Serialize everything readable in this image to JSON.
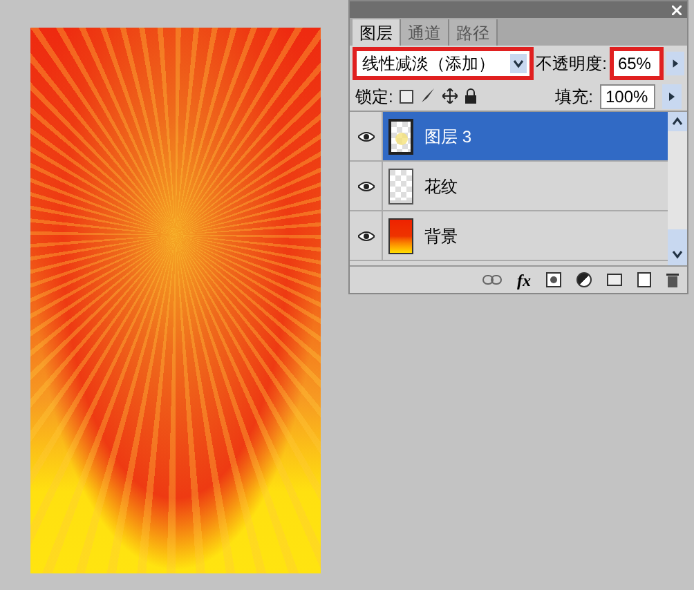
{
  "panel": {
    "tabs": [
      {
        "label": "图层",
        "selected": true
      },
      {
        "label": "通道",
        "selected": false
      },
      {
        "label": "路径",
        "selected": false
      }
    ],
    "blend_mode": {
      "value": "线性减淡（添加）",
      "highlighted": true
    },
    "opacity": {
      "label": "不透明度:",
      "value": "65%",
      "highlighted": true
    },
    "lock": {
      "label": "锁定:"
    },
    "fill": {
      "label": "填充:",
      "value": "100%"
    },
    "layers": [
      {
        "name": "图层 3",
        "selected": true,
        "visible": true,
        "kind": "glow"
      },
      {
        "name": "花纹",
        "selected": false,
        "visible": true,
        "kind": "pattern"
      },
      {
        "name": "背景",
        "selected": false,
        "visible": true,
        "kind": "background"
      }
    ],
    "footer": {
      "fx_label": "fx"
    }
  }
}
